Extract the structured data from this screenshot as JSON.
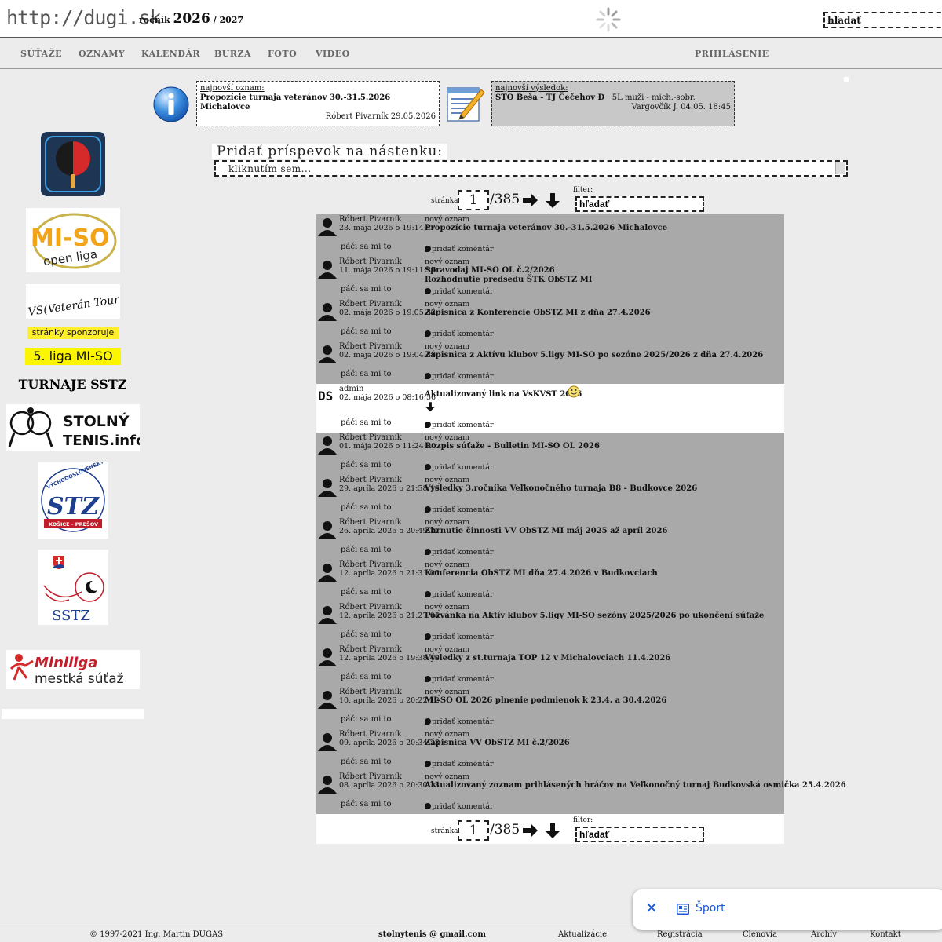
{
  "header": {
    "site_title": "http://dugi.sk",
    "season_word": "ročník",
    "season_current": "2026",
    "season_sep": " / ",
    "season_next": "2027",
    "search_placeholder": "hľadať"
  },
  "nav": {
    "items": [
      "SÚŤAŽE",
      "OZNAMY",
      "KALENDÁR",
      "BURZA",
      "FOTO",
      "VIDEO"
    ],
    "login": "PRIHLÁSENIE"
  },
  "latest_notice": {
    "label": "najnovší oznam:",
    "title": "Propozície turnaja veteránov 30.-31.5.2026 Michalovce",
    "meta": "Róbert Pivarník 29.05.2026"
  },
  "latest_result": {
    "label": "najnovší výsledok:",
    "title": "STO Beša - TJ Čečehov D",
    "league": "5L muži - mich.-sobr.",
    "meta": "Vargovčík J. 04.05. 18:45"
  },
  "sidebar": {
    "logo_miso_line1": "MI-SO",
    "logo_miso_line2": "open liga",
    "logo_vt": "VS(Veterán Tour",
    "sponsor_label": "stránky sponzoruje",
    "sponsor_league": "5. liga MI-SO",
    "tournaments": "TURNAJE SSTZ",
    "logo_stolny_line1": "STOLNÝ",
    "logo_stolny_line2": "TENIS.info",
    "logo_vsstz_text": "VÝCHODOSLOVENSKÝ",
    "logo_vsstz_sub": "KOŠICE - PREŠOV",
    "logo_sstz_text": "SSTZ",
    "logo_miniliga_line1": "Miniliga",
    "logo_miniliga_line2": "mestká súťaž"
  },
  "post_box": {
    "label": "Pridať príspevok na nástenku:",
    "placeholder": "kliknutím sem..."
  },
  "pager": {
    "label": "stránka",
    "page": "1",
    "total": "/385",
    "filter_label": "filter:",
    "search_placeholder": "hľadať"
  },
  "feed": {
    "like_label": "páči sa mi to",
    "comment_label": "pridať komentár",
    "posts": [
      {
        "author": "Róbert Pivarník",
        "date": "23. mája 2026 o 19:14:47",
        "kind": "nový oznam",
        "title": "Propozície turnaja veteránov 30.-31.5.2026 Michalovce",
        "title2": ""
      },
      {
        "author": "Róbert Pivarník",
        "date": "11. mája 2026 o 19:11:37",
        "kind": "nový oznam",
        "title": "Spravodaj MI-SO OL č.2/2026",
        "title2": "Rozhodnutie predsedu ŠTK ObSTZ MI"
      },
      {
        "author": "Róbert Pivarník",
        "date": "02. mája 2026 o 19:05:32",
        "kind": "nový oznam",
        "title": "Zápisnica z Konferencie ObSTZ MI z dňa 27.4.2026",
        "title2": ""
      },
      {
        "author": "Róbert Pivarník",
        "date": "02. mája 2026 o 19:04:39",
        "kind": "nový oznam",
        "title": "Zápisnica z Aktívu klubov 5.ligy MI-SO po sezóne 2025/2026 z dňa 27.4.2026",
        "title2": ""
      },
      {
        "author": "admin",
        "date": "02. mája 2026 o 08:16:56",
        "kind": "",
        "title": "Aktualizovaný link na VsKVST 2026",
        "title2": ""
      },
      {
        "author": "Róbert Pivarník",
        "date": "01. mája 2026 o 11:24:00",
        "kind": "nový oznam",
        "title": "Rozpis súťaže - Bulletin MI-SO OL 2026",
        "title2": ""
      },
      {
        "author": "Róbert Pivarník",
        "date": "29. apríla 2026 o 21:58:16",
        "kind": "nový oznam",
        "title": "Výsledky 3.ročníka Veľkonočného turnaja B8 - Budkovce 2026",
        "title2": ""
      },
      {
        "author": "Róbert Pivarník",
        "date": "26. apríla 2026 o 20:49:27",
        "kind": "nový oznam",
        "title": "Zhrnutie činnosti VV ObSTZ MI máj 2025 až apríl 2026",
        "title2": ""
      },
      {
        "author": "Róbert Pivarník",
        "date": "12. apríla 2026 o 21:31:05",
        "kind": "nový oznam",
        "title": "Konferencia ObSTZ MI dňa 27.4.2026 v Budkovciach",
        "title2": ""
      },
      {
        "author": "Róbert Pivarník",
        "date": "12. apríla 2026 o 21:27:05",
        "kind": "nový oznam",
        "title": "Pozvánka na Aktív klubov 5.ligy MI-SO sezóny 2025/2026 po ukončení súťaže",
        "title2": ""
      },
      {
        "author": "Róbert Pivarník",
        "date": "12. apríla 2026 o 19:38:40",
        "kind": "nový oznam",
        "title": "Výsledky z st.turnaja TOP 12 v Michalovciach 11.4.2026",
        "title2": ""
      },
      {
        "author": "Róbert Pivarník",
        "date": "10. apríla 2026 o 20:22:12",
        "kind": "nový oznam",
        "title": "MI-SO OL 2026 plnenie podmienok k 23.4. a 30.4.2026",
        "title2": ""
      },
      {
        "author": "Róbert Pivarník",
        "date": "09. apríla 2026 o 20:34:28",
        "kind": "nový oznam",
        "title": "Zápisnica VV ObSTZ MI č.2/2026",
        "title2": ""
      },
      {
        "author": "Róbert Pivarník",
        "date": "08. apríla 2026 o 20:30:23",
        "kind": "nový oznam",
        "title": "Aktualizovaný zoznam prihlásených hráčov na Veľkonočný turnaj Budkovská osmička 25.4.2026",
        "title2": ""
      }
    ]
  },
  "footer": {
    "copyright": "© 1997-2021  Ing. Martin DUGAS",
    "email": "stolnytenis @ gmail.com",
    "links": [
      "Aktualizácie",
      "Registrácia",
      "Členovia",
      "Archív",
      "Kontakt"
    ]
  },
  "toast": {
    "label": "Šport"
  }
}
